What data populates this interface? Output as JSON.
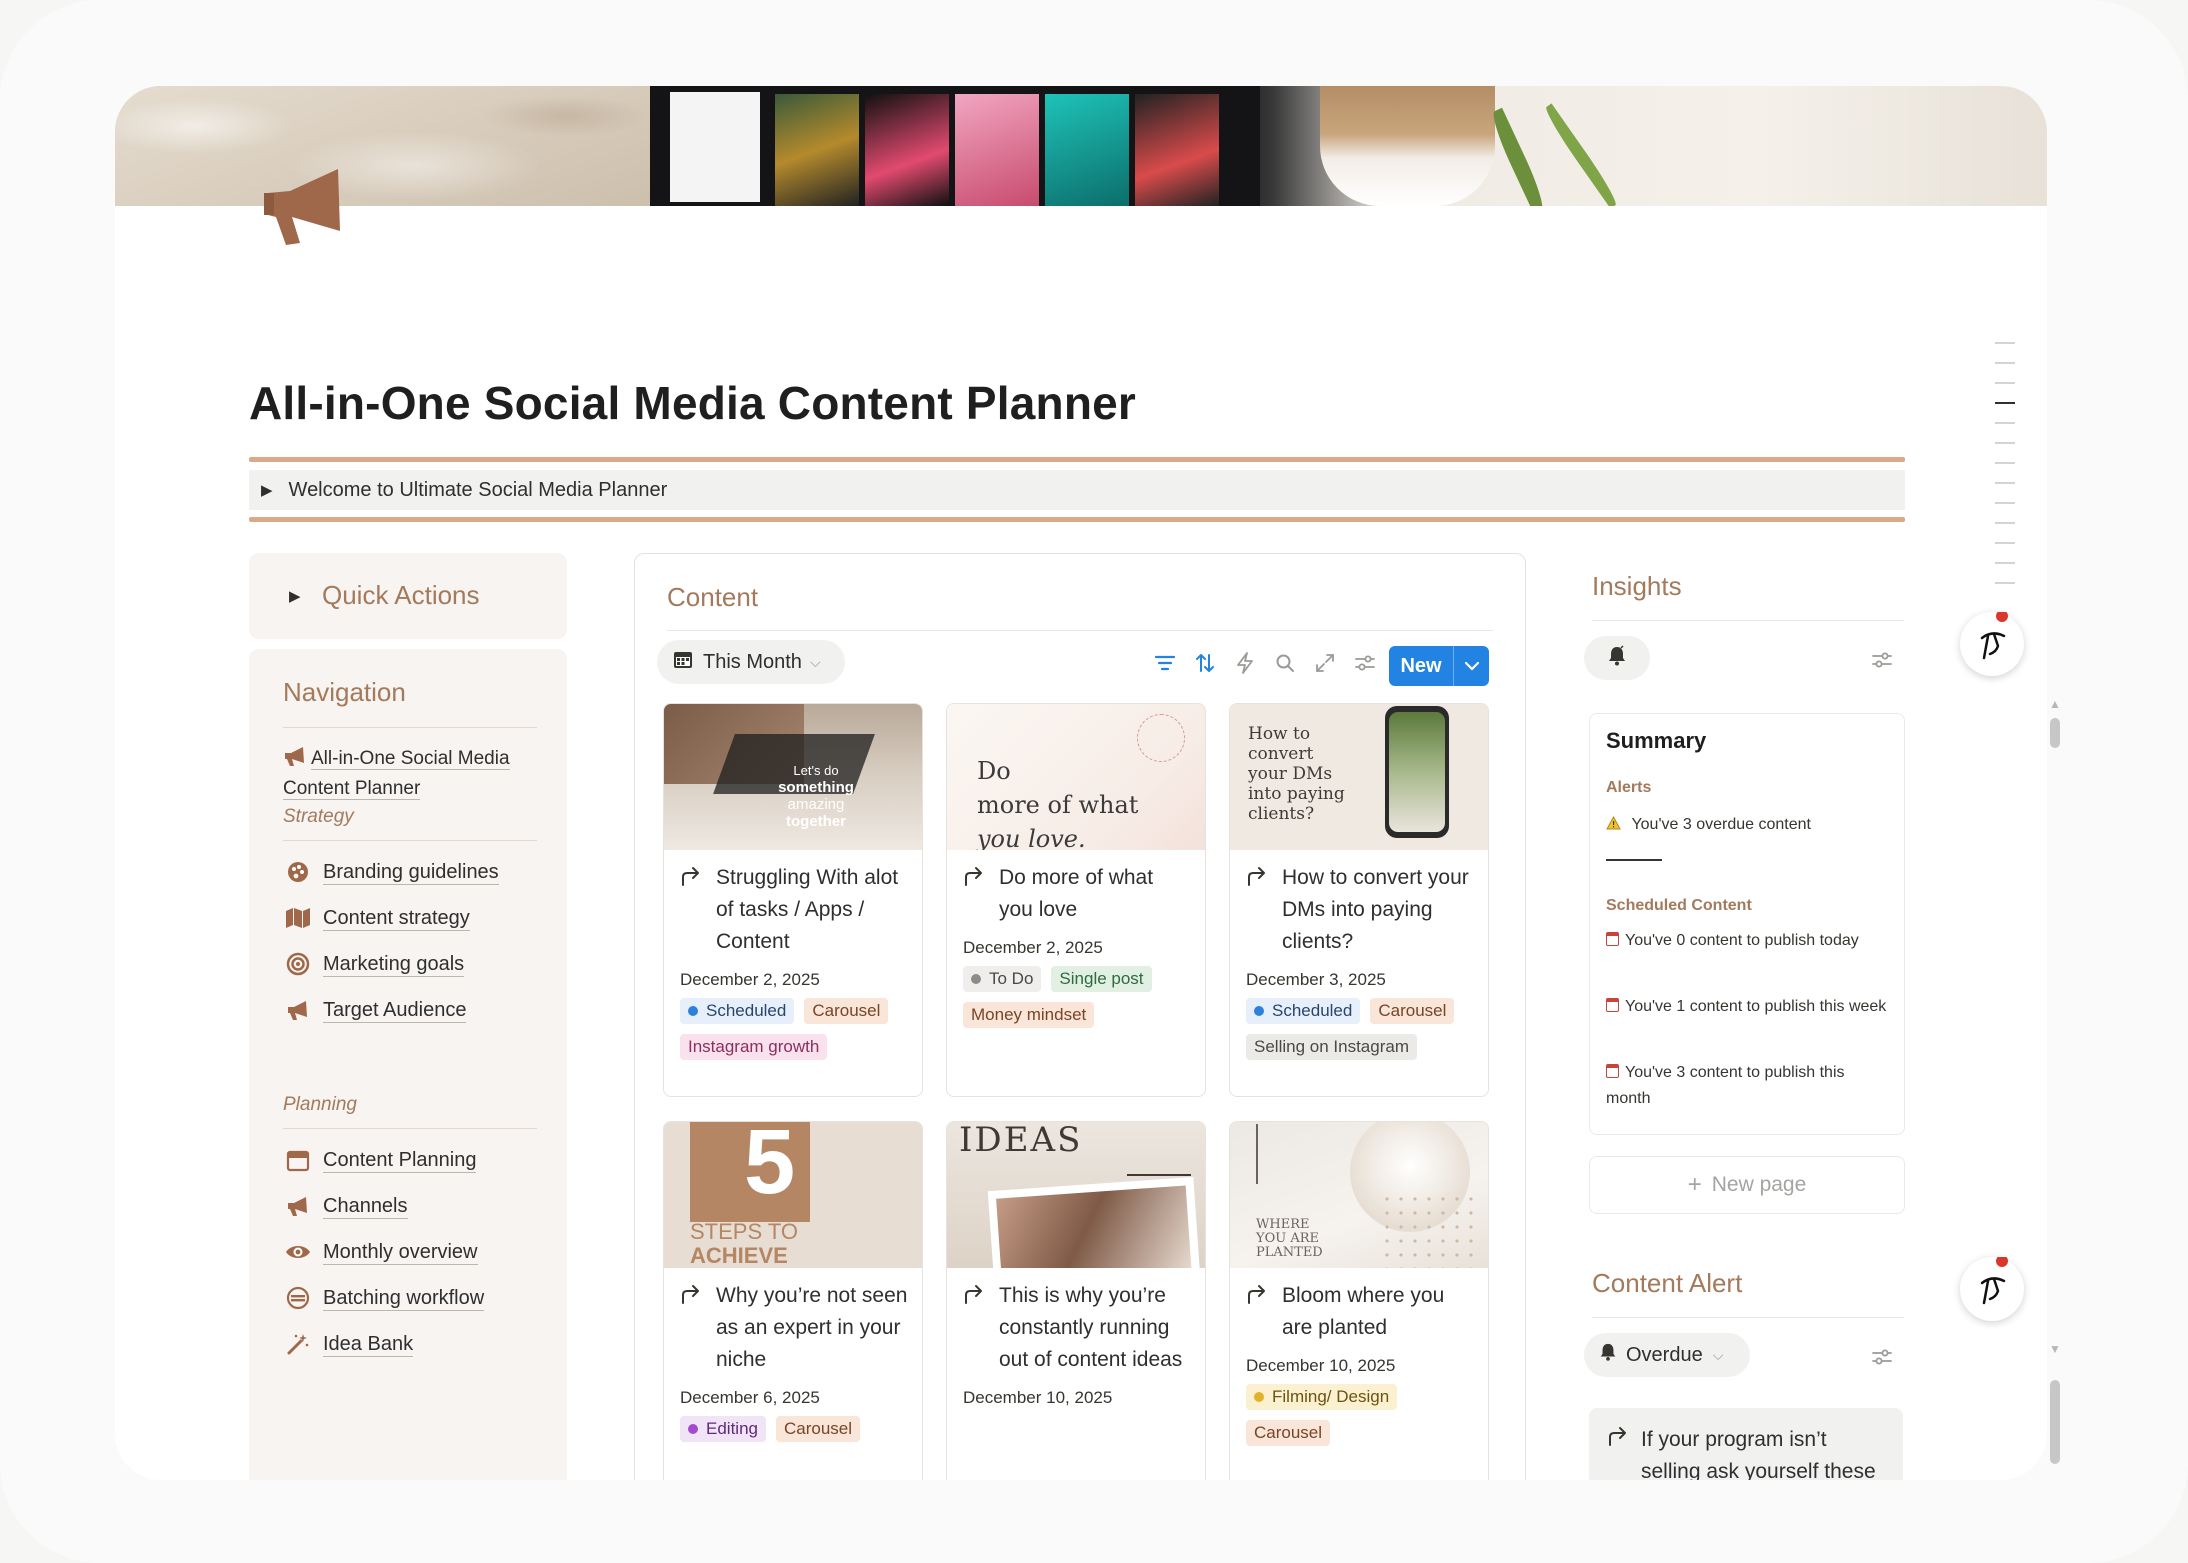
{
  "page": {
    "title": "All-in-One Social Media Content Planner",
    "welcome_toggle": "Welcome to Ultimate Social Media Planner",
    "cover": {
      "icon": "megaphone-icon",
      "brand_color": "#a0684a"
    }
  },
  "sidebar": {
    "quick_actions": "Quick Actions",
    "navigation_title": "Navigation",
    "home_link": "All-in-One Social Media Content Planner",
    "sections": [
      {
        "title": "Strategy",
        "items": [
          {
            "label": "Branding guidelines",
            "icon": "palette-icon"
          },
          {
            "label": "Content strategy",
            "icon": "map-icon"
          },
          {
            "label": "Marketing goals",
            "icon": "target-icon"
          },
          {
            "label": "Target Audience",
            "icon": "megaphone-icon"
          }
        ]
      },
      {
        "title": "Planning",
        "items": [
          {
            "label": "Content Planning",
            "icon": "calendar-icon"
          },
          {
            "label": "Channels",
            "icon": "megaphone-icon"
          },
          {
            "label": "Monthly overview",
            "icon": "eye-icon"
          },
          {
            "label": "Batching workflow",
            "icon": "stack-icon"
          },
          {
            "label": "Idea Bank",
            "icon": "magic-wand-icon"
          }
        ]
      }
    ]
  },
  "content": {
    "title": "Content",
    "view": "This Month",
    "new_button": "New",
    "toolbar_icons": [
      "filter-icon",
      "sort-icon",
      "automation-icon",
      "search-icon",
      "expand-icon",
      "settings-icon"
    ],
    "cards": [
      {
        "title": "Struggling With alot of tasks / Apps / Content",
        "date": "December 2, 2025",
        "image_text": [
          "Let's do",
          "something",
          "amazing",
          "together"
        ],
        "tags": [
          {
            "label": "Scheduled",
            "kind": "status-blue"
          },
          {
            "label": "Carousel",
            "kind": "orange"
          },
          {
            "label": "Instagram growth",
            "kind": "pink"
          }
        ]
      },
      {
        "title": "Do more of what you love",
        "date": "December 2, 2025",
        "image_text": [
          "Do",
          "more of what",
          "you love."
        ],
        "tags": [
          {
            "label": "To Do",
            "kind": "status-gray"
          },
          {
            "label": "Single post",
            "kind": "green"
          },
          {
            "label": "Money mindset",
            "kind": "orange"
          }
        ]
      },
      {
        "title": "How to convert your DMs into paying clients?",
        "date": "December 3, 2025",
        "image_text": [
          "How to",
          "convert",
          "your DMs",
          "into paying",
          "clients?"
        ],
        "tags": [
          {
            "label": "Scheduled",
            "kind": "status-blue"
          },
          {
            "label": "Carousel",
            "kind": "orange"
          },
          {
            "label": "Selling on Instagram",
            "kind": "gray"
          }
        ]
      },
      {
        "title": "Why you’re not seen as an expert in your niche",
        "date": "December 6, 2025",
        "image_text": [
          "5",
          "STEPS TO",
          "ACHIEVE"
        ],
        "tags": [
          {
            "label": "Editing",
            "kind": "status-purple"
          },
          {
            "label": "Carousel",
            "kind": "orange"
          }
        ]
      },
      {
        "title": "This is why you’re constantly running out of content ideas",
        "date": "December 10, 2025",
        "image_text": [
          "IDEAS"
        ],
        "tags": []
      },
      {
        "title": "Bloom where you are planted",
        "date": "December 10, 2025",
        "image_text": [
          "WHERE",
          "YOU ARE",
          "PLANTED"
        ],
        "tags": [
          {
            "label": "Filming/ Design",
            "kind": "status-yellow"
          },
          {
            "label": "Carousel",
            "kind": "orange"
          }
        ]
      }
    ]
  },
  "insights": {
    "title": "Insights",
    "summary": {
      "heading": "Summary",
      "alerts_label": "Alerts",
      "overdue_line": "You've 3 overdue content",
      "scheduled_label": "Scheduled Content",
      "lines": [
        "You've 0 content to publish today",
        "You've 1 content to publish this week",
        "You've 3 content to publish this month"
      ]
    },
    "new_page": "New page"
  },
  "content_alert": {
    "title": "Content Alert",
    "filter": "Overdue",
    "card_title": "If your program isn’t selling ask yourself these"
  }
}
